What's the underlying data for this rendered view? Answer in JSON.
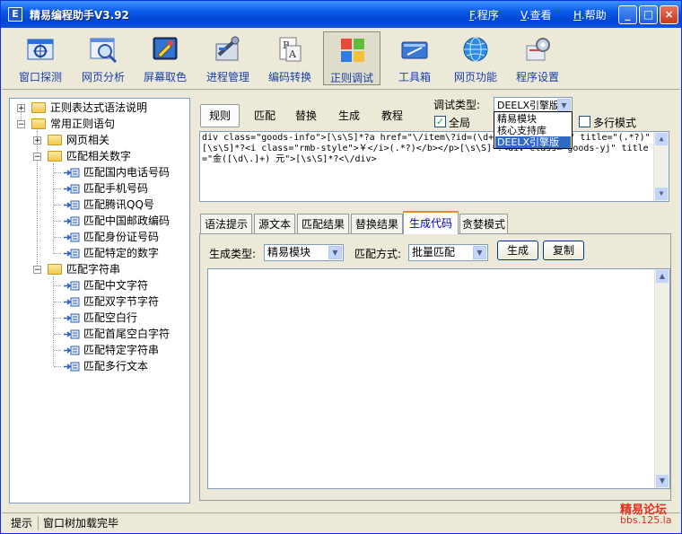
{
  "app": {
    "title": "精易编程助手V3.92"
  },
  "menu": [
    {
      "key": "F",
      "label": ".程序"
    },
    {
      "key": "V",
      "label": ".查看"
    },
    {
      "key": "H",
      "label": ".帮助"
    }
  ],
  "window_controls": {
    "minimize": "_",
    "maximize": "□",
    "close": "×"
  },
  "toolbar": [
    {
      "label": "窗口探测",
      "icon": "window-probe-icon"
    },
    {
      "label": "网页分析",
      "icon": "web-analysis-icon"
    },
    {
      "label": "屏幕取色",
      "icon": "color-picker-icon"
    },
    {
      "label": "进程管理",
      "icon": "process-manager-icon"
    },
    {
      "label": "编码转换",
      "icon": "encoding-convert-icon"
    },
    {
      "label": "正则调试",
      "icon": "regex-debug-icon",
      "active": true
    },
    {
      "label": "工具箱",
      "icon": "toolbox-icon"
    },
    {
      "label": "网页功能",
      "icon": "web-function-icon"
    },
    {
      "label": "程序设置",
      "icon": "settings-icon"
    }
  ],
  "tree": {
    "root1": "正则表达式语法说明",
    "root2": "常用正则语句",
    "web": "网页相关",
    "numbers": "匹配相关数字",
    "number_items": [
      "匹配国内电话号码",
      "匹配手机号码",
      "匹配腾讯QQ号",
      "匹配中国邮政编码",
      "匹配身份证号码",
      "匹配特定的数字"
    ],
    "strings": "匹配字符串",
    "string_items": [
      "匹配中文字符",
      "匹配双字节字符",
      "匹配空白行",
      "匹配首尾空白字符",
      "匹配特定字符串",
      "匹配多行文本"
    ]
  },
  "top_tabs": [
    "规则",
    "匹配",
    "替换",
    "生成",
    "教程"
  ],
  "debug_type": {
    "label": "调试类型:",
    "value": "DEELX引擎版",
    "options": [
      "精易模块",
      "核心支持库",
      "DEELX引擎版"
    ]
  },
  "global_checkbox": {
    "label": "全局",
    "checked": true
  },
  "multiline_checkbox": {
    "label": "多行模式",
    "checked": false
  },
  "regex_text": "div class=\"goods-info\">[\\s\\S]*?a href=\"\\/item\\?id=(\\d+)\" class=\"name\" title=\"(.*?)\"[\\s\\S]*?<i class=\"rmb-style\">￥</i>(.*?)</b></p>[\\s\\S]*?<div class=\"goods-yj\" title=\"金([\\d\\.]+) 元\">[\\s\\S]*?<\\/div>",
  "bottom_tabs": [
    "语法提示",
    "源文本",
    "匹配结果",
    "替换结果",
    "生成代码",
    "贪婪模式"
  ],
  "generate": {
    "type_label": "生成类型:",
    "type_value": "精易模块",
    "mode_label": "匹配方式:",
    "mode_value": "批量匹配",
    "gen_button": "生成",
    "copy_button": "复制",
    "output": ""
  },
  "status": {
    "hint": "提示",
    "message": "窗口树加载完毕"
  },
  "watermark": {
    "line1": "精易论坛",
    "line2": "bbs.125.la"
  }
}
